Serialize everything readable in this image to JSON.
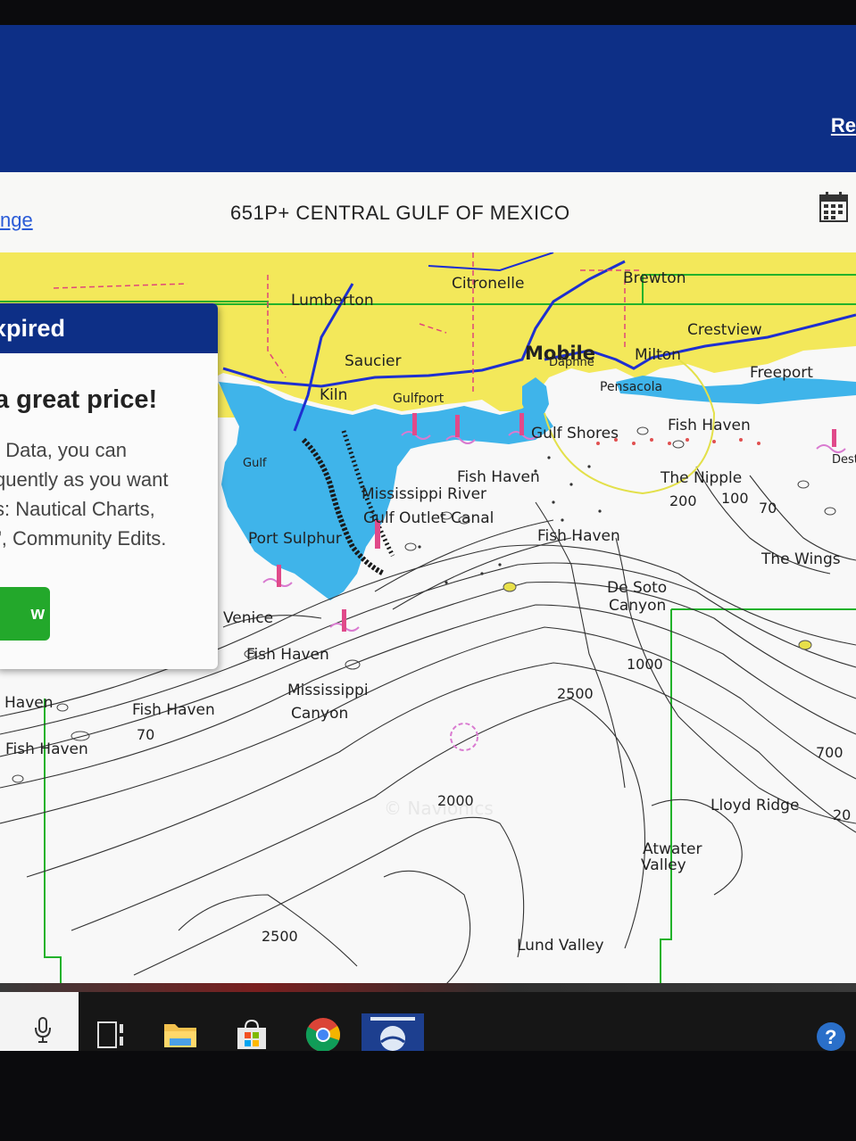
{
  "header": {
    "corner_link": "Re",
    "left_link": "nge",
    "chart_title": "651P+ CENTRAL GULF OF MEXICO"
  },
  "map": {
    "watermark": "© Navionics",
    "place_labels": [
      "Lumberton",
      "Citronelle",
      "Brewton",
      "Crestview",
      "Saucier",
      "Mobile",
      "Milton",
      "Freeport",
      "Kiln",
      "Gulfport",
      "Pensacola",
      "Gulf Shores",
      "Fish Haven",
      "Mississippi River",
      "Gulf Outlet Canal",
      "Port Sulphur",
      "Fish Haven",
      "The Nipple",
      "Fish Haven",
      "The Wings",
      "De Soto",
      "Canyon",
      "Fish Haven",
      "Mississippi",
      "Canyon",
      "Fish Haven",
      "Haven",
      "Fish Haven",
      "Lloyd Ridge",
      "Atwater",
      "Valley",
      "Lund Valley",
      "Daphne",
      "Destin",
      "Gulf",
      "Venice"
    ],
    "depth_labels": [
      "200",
      "100",
      "70",
      "1000",
      "2500",
      "700",
      "2000",
      "2500",
      "70",
      "20"
    ]
  },
  "popup": {
    "title": "xpired",
    "headline": "a great price!",
    "lines": [
      ": Data, you can",
      "quently as you want",
      "s: Nautical Charts,",
      "\", Community Edits."
    ],
    "button_label": "w"
  },
  "taskbar": {
    "icons": [
      "microphone-icon",
      "task-view-icon",
      "file-explorer-icon",
      "store-icon",
      "chrome-icon",
      "navionics-icon",
      "help-icon"
    ]
  }
}
